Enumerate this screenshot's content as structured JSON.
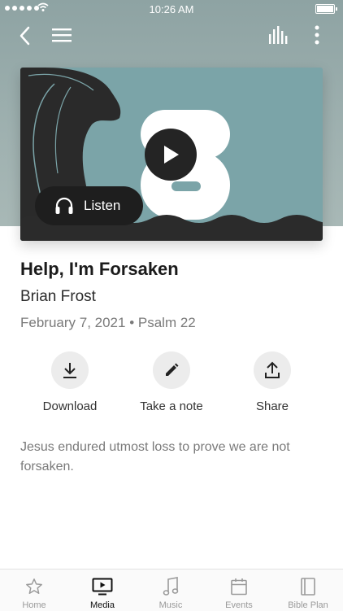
{
  "status_bar": {
    "time": "10:26 AM"
  },
  "media": {
    "listen_label": "Listen",
    "title": "Help, I'm Forsaken",
    "speaker": "Brian Frost",
    "date": "February 7, 2021",
    "separator": "•",
    "scripture": "Psalm 22",
    "description": "Jesus endured utmost loss to prove we are not forsaken."
  },
  "actions": [
    {
      "label": "Download",
      "icon": "download-icon"
    },
    {
      "label": "Take a note",
      "icon": "pencil-icon"
    },
    {
      "label": "Share",
      "icon": "share-icon"
    }
  ],
  "tabs": [
    {
      "label": "Home",
      "icon": "star-icon",
      "active": false
    },
    {
      "label": "Media",
      "icon": "tv-play-icon",
      "active": true
    },
    {
      "label": "Music",
      "icon": "music-note-icon",
      "active": false
    },
    {
      "label": "Events",
      "icon": "calendar-icon",
      "active": false
    },
    {
      "label": "Bible Plan",
      "icon": "book-icon",
      "active": false
    }
  ],
  "colors": {
    "accent": "#111111",
    "card_bg": "#7ba4a8",
    "header_bg": "#9fb1b0"
  }
}
